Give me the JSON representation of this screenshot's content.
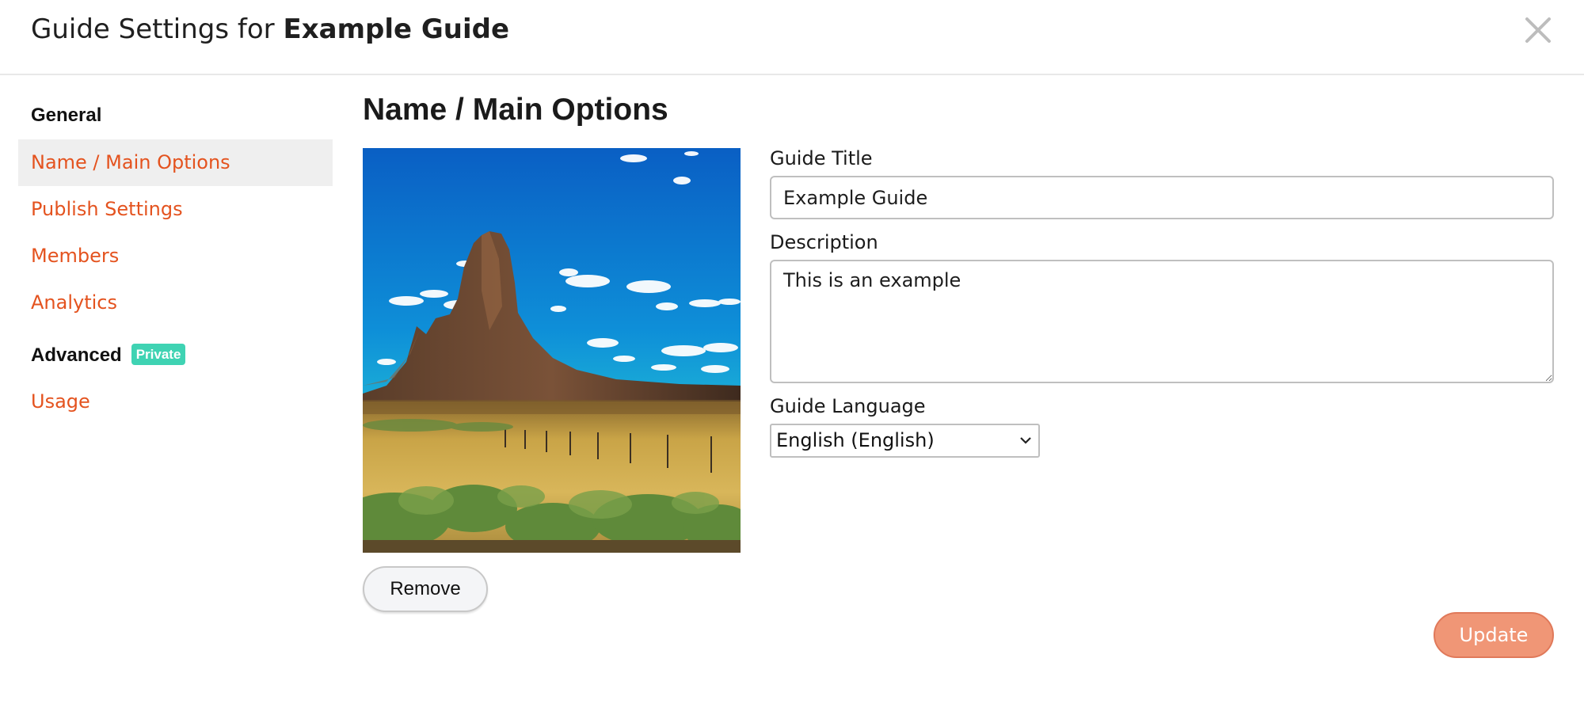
{
  "header": {
    "title_prefix": "Guide Settings for",
    "title_name": "Example Guide"
  },
  "sidebar": {
    "general_heading": "General",
    "items": [
      {
        "label": "Name / Main Options",
        "active": true
      },
      {
        "label": "Publish Settings"
      },
      {
        "label": "Members"
      },
      {
        "label": "Analytics"
      }
    ],
    "advanced_heading": "Advanced",
    "advanced_badge": "Private",
    "advanced_items": [
      {
        "label": "Usage"
      }
    ]
  },
  "main": {
    "title": "Name / Main Options",
    "image_alt": "desert-butte-landscape",
    "remove_label": "Remove",
    "guide_title_label": "Guide Title",
    "guide_title_value": "Example Guide",
    "description_label": "Description",
    "description_value": "This is an example",
    "language_label": "Guide Language",
    "language_value": "English (English)",
    "update_label": "Update"
  },
  "colors": {
    "accent": "#e4531f",
    "badge": "#3fd3b3",
    "update_button": "#f09676"
  }
}
